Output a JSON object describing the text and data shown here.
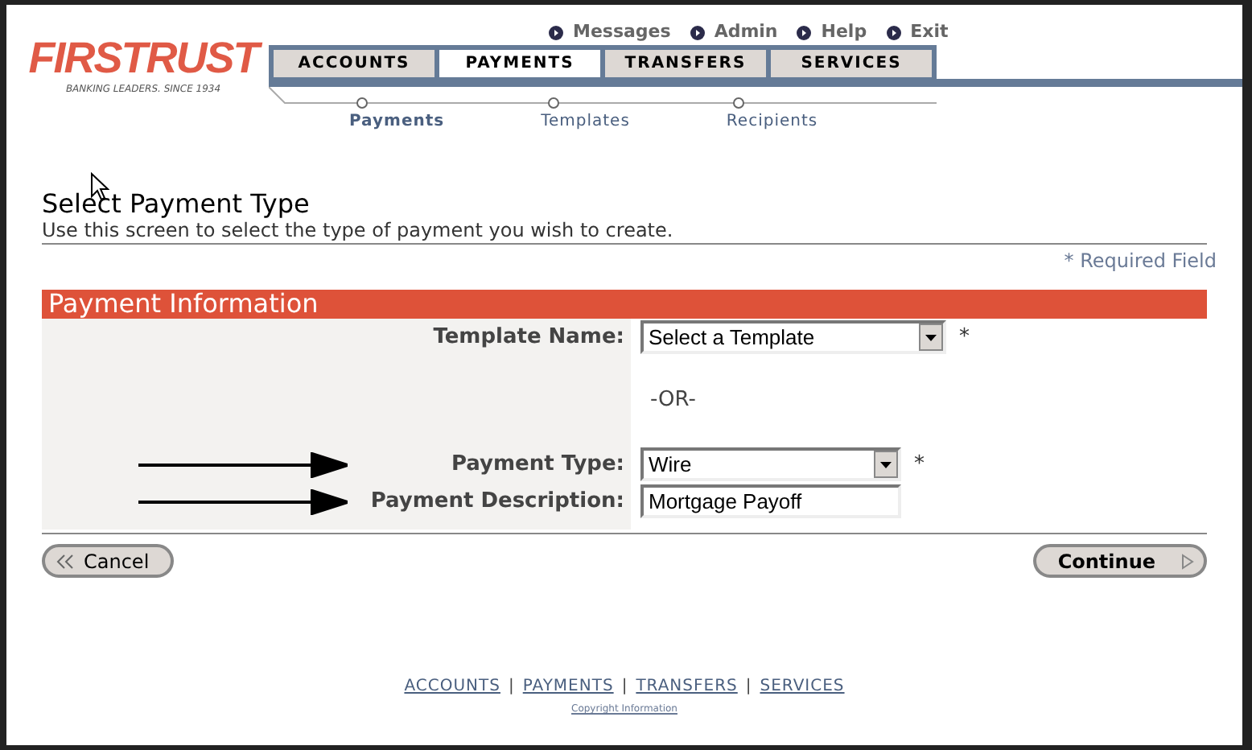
{
  "logo": {
    "name": "FIRSTRUST",
    "tagline": "BANKING LEADERS. SINCE 1934"
  },
  "top_links": [
    "Messages",
    "Admin",
    "Help",
    "Exit"
  ],
  "tabs": [
    {
      "label": "ACCOUNTS",
      "selected": false
    },
    {
      "label": "PAYMENTS",
      "selected": true
    },
    {
      "label": "TRANSFERS",
      "selected": false
    },
    {
      "label": "SERVICES",
      "selected": false
    }
  ],
  "subnav": [
    {
      "label": "Payments",
      "selected": true
    },
    {
      "label": "Templates",
      "selected": false
    },
    {
      "label": "Recipients",
      "selected": false
    }
  ],
  "title": "Select Payment Type",
  "description": "Use this screen to select the type of payment you wish to create.",
  "required_note": "* Required Field",
  "section": {
    "title": "Payment Information",
    "fields": [
      {
        "kind": "select",
        "label": "Template Name:",
        "value": "Select a Template",
        "required": true,
        "arrow": false
      },
      {
        "kind": "divider",
        "text": "-OR-"
      },
      {
        "kind": "select",
        "label": "Payment Type:",
        "value": "Wire",
        "required": true,
        "arrow": true
      },
      {
        "kind": "text",
        "label": "Payment Description:",
        "value": "Mortgage Payoff",
        "required": false,
        "arrow": true
      }
    ]
  },
  "required_mark": "*",
  "buttons": [
    {
      "label": "Cancel",
      "kind": "back"
    },
    {
      "label": "Continue",
      "kind": "forward"
    }
  ],
  "footer_links": [
    "ACCOUNTS",
    "PAYMENTS",
    "TRANSFERS",
    "SERVICES"
  ],
  "footer_separator": "|",
  "copyright": "Copyright Information"
}
